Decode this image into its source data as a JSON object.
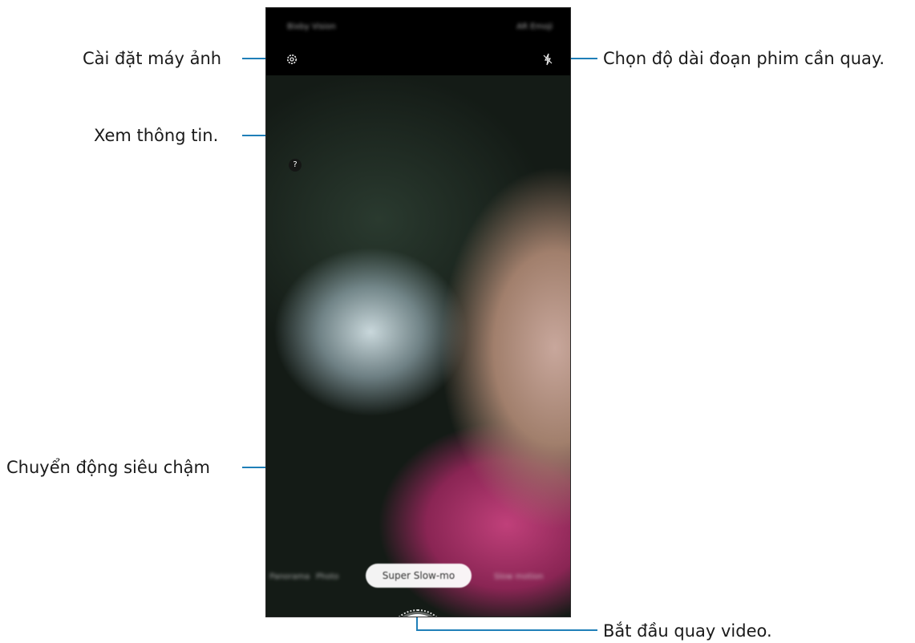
{
  "callouts": {
    "camera_settings": "Cài đặt máy ảnh",
    "view_info": "Xem thông tin.",
    "super_slow_mo": "Chuyển động siêu chậm",
    "clip_length": "Chọn độ dài đoạn phim cần quay.",
    "start_recording": "Bắt đầu quay video."
  },
  "screen": {
    "mode_left": "Bixby Vision",
    "mode_right": "AR Emoji",
    "info_glyph": "?",
    "mode_strip_left": "Panorama",
    "mode_strip_mid": "Photo",
    "selected_mode": "Super Slow-mo",
    "mode_strip_right": "Slow motion",
    "icons": [
      "settings-icon",
      "info-icon",
      "clip-length-icon",
      "bixby-icon",
      "record-icon",
      "flip-camera-icon"
    ]
  },
  "colors": {
    "leader": "#1f7fb8",
    "bixby": "#d6325a",
    "record_dot": "#d7262e"
  }
}
